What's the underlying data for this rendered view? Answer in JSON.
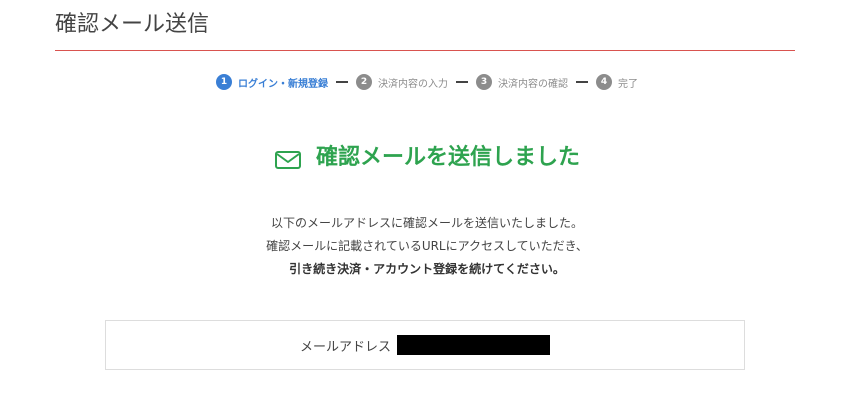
{
  "page": {
    "title": "確認メール送信"
  },
  "steps": [
    {
      "number": "1",
      "label": "ログイン・新規登録",
      "active": true
    },
    {
      "number": "2",
      "label": "決済内容の入力",
      "active": false
    },
    {
      "number": "3",
      "label": "決済内容の確認",
      "active": false
    },
    {
      "number": "4",
      "label": "完了",
      "active": false
    }
  ],
  "confirmation": {
    "icon": "mail-icon",
    "heading": "確認メールを送信しました",
    "message_line1": "以下のメールアドレスに確認メールを送信いたしました。",
    "message_line2": "確認メールに記載されているURLにアクセスしていただき、",
    "message_line3": "引き続き決済・アカウント登録を続けてください。"
  },
  "email": {
    "label": "メールアドレス"
  },
  "colors": {
    "accent_blue": "#3a7fd5",
    "success_green": "#2ea34f",
    "title_rule_red": "#d9534f",
    "inactive_gray": "#8c8c8c"
  }
}
